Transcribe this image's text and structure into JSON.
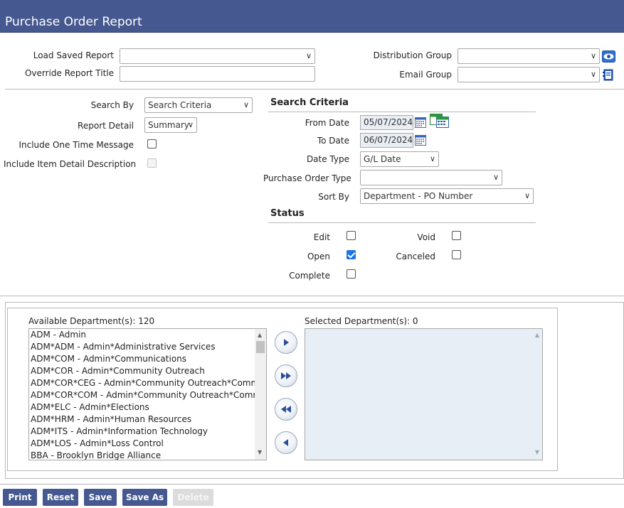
{
  "header": {
    "title": "Purchase Order Report"
  },
  "top_form": {
    "load_saved_report_label": "Load Saved Report",
    "override_title_label": "Override Report Title",
    "distribution_group_label": "Distribution Group",
    "email_group_label": "Email Group",
    "load_saved_report_value": "",
    "override_title_value": "",
    "distribution_group_value": "",
    "email_group_value": ""
  },
  "options": {
    "search_by_label": "Search By",
    "search_by_value": "Search Criteria",
    "report_detail_label": "Report Detail",
    "report_detail_value": "Summary",
    "one_time_msg_label": "Include One Time Message",
    "item_detail_label": "Include Item Detail Description"
  },
  "search_criteria": {
    "title": "Search Criteria",
    "from_date_label": "From Date",
    "from_date_value": "05/07/2024",
    "to_date_label": "To Date",
    "to_date_value": "06/07/2024",
    "date_type_label": "Date Type",
    "date_type_value": "G/L Date",
    "po_type_label": "Purchase Order Type",
    "po_type_value": "",
    "sort_by_label": "Sort By",
    "sort_by_value": "Department - PO Number"
  },
  "status": {
    "title": "Status",
    "edit_label": "Edit",
    "void_label": "Void",
    "open_label": "Open",
    "canceled_label": "Canceled",
    "complete_label": "Complete",
    "edit_checked": false,
    "void_checked": false,
    "open_checked": true,
    "canceled_checked": false,
    "complete_checked": false
  },
  "departments": {
    "available_label": "Available Department(s): 120",
    "selected_label": "Selected Department(s): 0",
    "available_items": [
      "ADM - Admin",
      "ADM*ADM - Admin*Administrative Services",
      "ADM*COM - Admin*Communications",
      "ADM*COR - Admin*Community Outreach",
      "ADM*COR*CEG - Admin*Community Outreach*Community",
      "ADM*COR*COM - Admin*Community Outreach*Communic",
      "ADM*ELC - Admin*Elections",
      "ADM*HRM - Admin*Human Resources",
      "ADM*ITS - Admin*Information Technology",
      "ADM*LOS - Admin*Loss Control",
      "BBA - Brooklyn Bridge Alliance"
    ],
    "selected_items": []
  },
  "buttons": {
    "print": "Print",
    "reset": "Reset",
    "save": "Save",
    "save_as": "Save As",
    "delete": "Delete"
  },
  "colors": {
    "header_bg": "#45588f",
    "button_bg": "#45588f",
    "accent": "#1a73e8"
  },
  "icons": {
    "distribution_view": "eye-icon",
    "email_group": "address-book-icon",
    "calendar": "calendar-icon",
    "date_range": "date-range-icon",
    "move_right": "arrow-right-icon",
    "move_all_right": "double-arrow-right-icon",
    "move_all_left": "double-arrow-left-icon",
    "move_left": "arrow-left-icon"
  }
}
